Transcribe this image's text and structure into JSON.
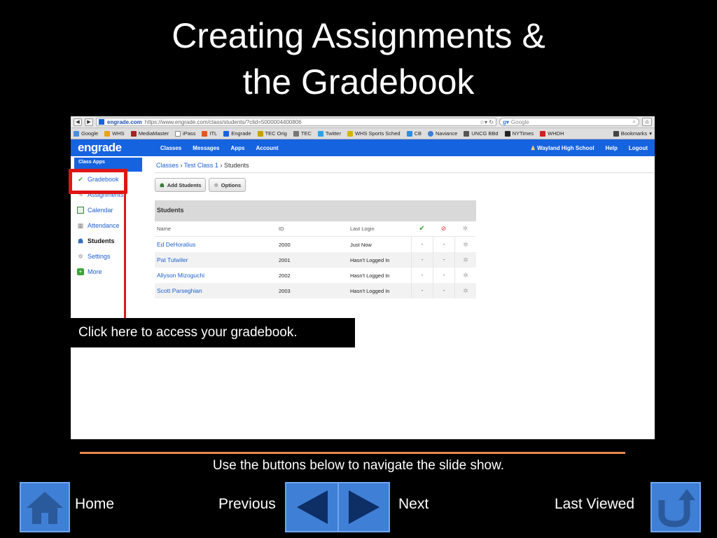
{
  "slide": {
    "title_line1": "Creating Assignments &",
    "title_line2": "the Gradebook",
    "callout": "Click here to access your gradebook.",
    "hint": "Use the buttons below to navigate the slide show.",
    "nav": {
      "home": "Home",
      "previous": "Previous",
      "next": "Next",
      "last_viewed": "Last Viewed"
    }
  },
  "browser": {
    "back": "◀",
    "forward": "▶",
    "site": "engrade.com",
    "url": "https://www.engrade.com/class/students/?clid=5000004400806",
    "search_placeholder": "Google",
    "bookmarks": [
      "Google",
      "WHS",
      "MediaMaster",
      "iPass",
      "ITL",
      "Engrade",
      "TEC Orig",
      "TEC",
      "Twitter",
      "WHS Sports Sched",
      "CB",
      "Naviance",
      "UNCG BBd",
      "NYTimes",
      "WHDH"
    ],
    "bookmarks_menu": "Bookmarks"
  },
  "engrade": {
    "logo": "engrade",
    "nav": [
      "Classes",
      "Messages",
      "Apps",
      "Account"
    ],
    "school": "Wayland High School",
    "help": "Help",
    "logout": "Logout",
    "sidebar_header": "Class Apps",
    "sidebar": [
      "Gradebook",
      "Assignments",
      "Calendar",
      "Attendance",
      "Students",
      "Settings",
      "More"
    ],
    "crumbs": {
      "classes": "Classes",
      "class": "Test Class 1",
      "current": "Students",
      "sep": "›"
    },
    "buttons": {
      "add_students": "Add Students",
      "options": "Options"
    },
    "table": {
      "title": "Students",
      "headers": {
        "name": "Name",
        "id": "ID",
        "last_login": "Last Login"
      },
      "rows": [
        {
          "name": "Ed DeHoratius",
          "id": "2000",
          "login": "Just Now",
          "a": "-",
          "b": "-"
        },
        {
          "name": "Pat Tutwiler",
          "id": "2001",
          "login": "Hasn't Logged In",
          "a": "-",
          "b": "-"
        },
        {
          "name": "Allyson Mizoguchi",
          "id": "2002",
          "login": "Hasn't Logged In",
          "a": "-",
          "b": "-"
        },
        {
          "name": "Scott Parseghian",
          "id": "2003",
          "login": "Hasn't Logged In",
          "a": "-",
          "b": "-"
        }
      ]
    }
  },
  "colors": {
    "engrade_blue": "#1663e0",
    "highlight_red": "#e01616",
    "rule_orange": "#e8864c",
    "nav_button": "#3f7fd6"
  },
  "icons": {
    "home": "house-icon",
    "prev": "left-arrow-icon",
    "next": "right-arrow-icon",
    "last_viewed": "return-arrow-icon"
  }
}
